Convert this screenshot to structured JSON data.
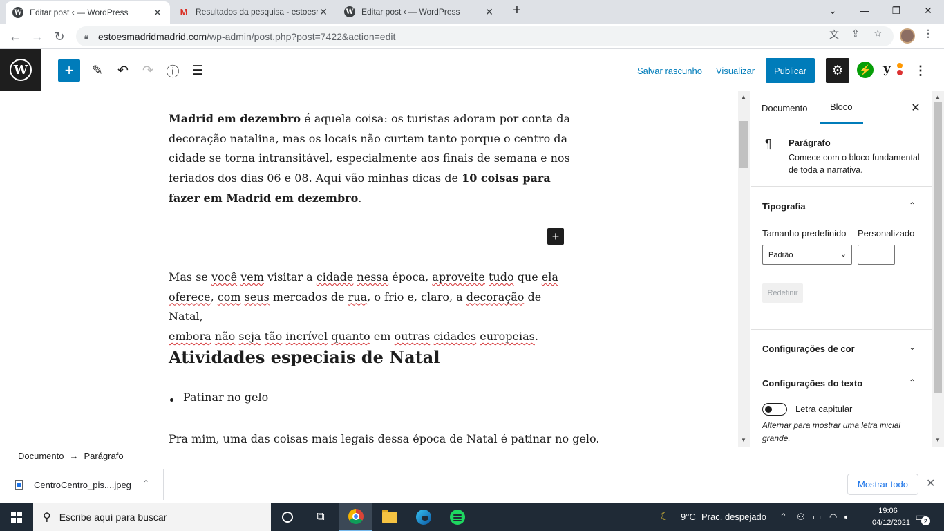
{
  "browser": {
    "tabs": [
      {
        "label": "Editar post ‹ — WordPress",
        "icon": "wordpress-icon"
      },
      {
        "label": "Resultados da pesquisa - estoesn",
        "icon": "gmail-icon"
      },
      {
        "label": "Editar post ‹ — WordPress",
        "icon": "wordpress-icon"
      }
    ],
    "url_host": "estoesmadridmadrid.com",
    "url_path": "/wp-admin/post.php?post=7422&action=edit"
  },
  "wp_header": {
    "save_draft": "Salvar rascunho",
    "preview": "Visualizar",
    "publish": "Publicar"
  },
  "content": {
    "p1": {
      "bold_start": "Madrid em dezembro",
      "text_mid": " é aquela coisa: os turistas adoram por conta da decoração natalina, mas os locais não curtem tanto porque o centro da cidade se torna intransitável, especialmente aos finais de semana e nos feriados dos dias 06 e 08. Aqui vão minhas dicas de ",
      "bold_end": "10 coisas para fazer em Madrid em dezembro",
      "text_end": "."
    },
    "p2": {
      "w1": "Mas se ",
      "w2": "você",
      "w3": " ",
      "w4": "vem",
      "w5": " visitar a ",
      "w6": "cidade",
      "w7": " ",
      "w8": "nessa",
      "w9": " época, ",
      "w10": "aproveite",
      "w11": " ",
      "w12": "tudo",
      "w13": " que ",
      "w14": "ela",
      "w15": "oferece",
      "w16": ", ",
      "w17": "com",
      "w18": " ",
      "w19": "seus",
      "w20": " mercados de ",
      "w21": "rua",
      "w22": ", o frio e, claro, a ",
      "w23": "decoração",
      "w24": " de Natal, ",
      "w25": "embora",
      "w26": " ",
      "w27": "não",
      "w28": " ",
      "w29": "seja",
      "w30": " ",
      "w31": "tão",
      "w32": " ",
      "w33": "incrível",
      "w34": " ",
      "w35": "quanto",
      "w36": " em ",
      "w37": "outras",
      "w38": " ",
      "w39": "cidades",
      "w40": " ",
      "w41": "europeias",
      "w42": "."
    },
    "heading": "Atividades especiais de Natal",
    "bullet": "Patinar no gelo",
    "p3": "Pra mim, uma das coisas mais legais dessa época de Natal é patinar no gelo."
  },
  "sidebar": {
    "tab_document": "Documento",
    "tab_block": "Bloco",
    "block_title": "Parágrafo",
    "block_desc": "Comece com o bloco fundamental de toda a narrativa.",
    "typography": "Tipografia",
    "preset_size_label": "Tamanho predefinido",
    "custom_label": "Personalizado",
    "preset_value": "Padrão",
    "custom_value": "",
    "reset": "Redefinir",
    "color_settings": "Configurações de cor",
    "text_settings": "Configurações do texto",
    "drop_cap": "Letra capitular",
    "drop_cap_help": "Alternar para mostrar uma letra inicial grande."
  },
  "footer": {
    "crumb_root": "Documento",
    "crumb_current": "Parágrafo"
  },
  "downloads": {
    "file": "CentroCentro_pis....jpeg",
    "show_all": "Mostrar todo"
  },
  "taskbar": {
    "search_placeholder": "Escribe aquí para buscar",
    "weather_temp": "9°C",
    "weather_desc": "Prac. despejado",
    "time": "19:06",
    "date": "04/12/2021",
    "notifications": "2"
  },
  "colors": {
    "wp_blue": "#007cba",
    "wp_dark": "#1e1e1e",
    "taskbar": "#1f2a36"
  }
}
